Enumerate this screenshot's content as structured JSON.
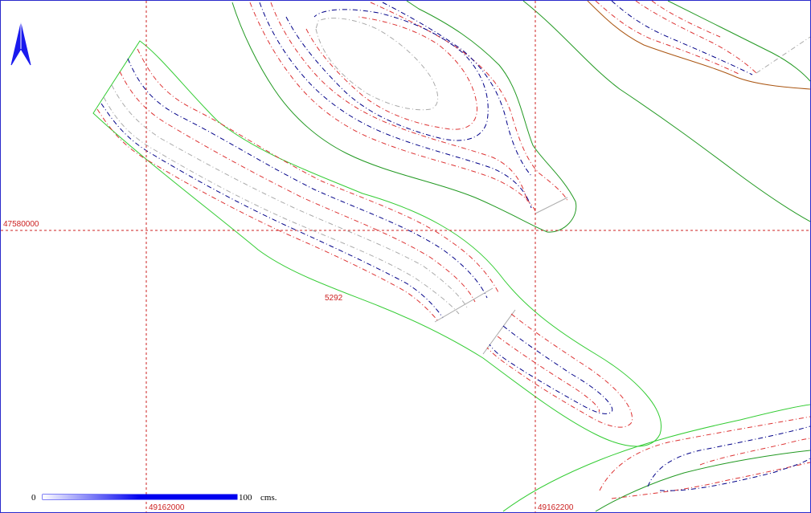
{
  "map": {
    "north_arrow_icon": "north-arrow-icon",
    "grid": {
      "color": "#cc2222",
      "y_label": "47580000",
      "x_labels": [
        "49162000",
        "49162200"
      ]
    },
    "parcel_label": "5292",
    "scale_bar": {
      "start_label": "0",
      "end_label": "100",
      "unit_label": "cms.",
      "fill_color": "#0000ee"
    },
    "colors": {
      "frame": "#2a2acc",
      "contour_green": "#33cc33",
      "contour_dark_green": "#229922",
      "contour_brown": "#aa5511",
      "contour_red": "#dd3333",
      "contour_blue": "#000088",
      "contour_gray": "#aaaaaa"
    }
  }
}
